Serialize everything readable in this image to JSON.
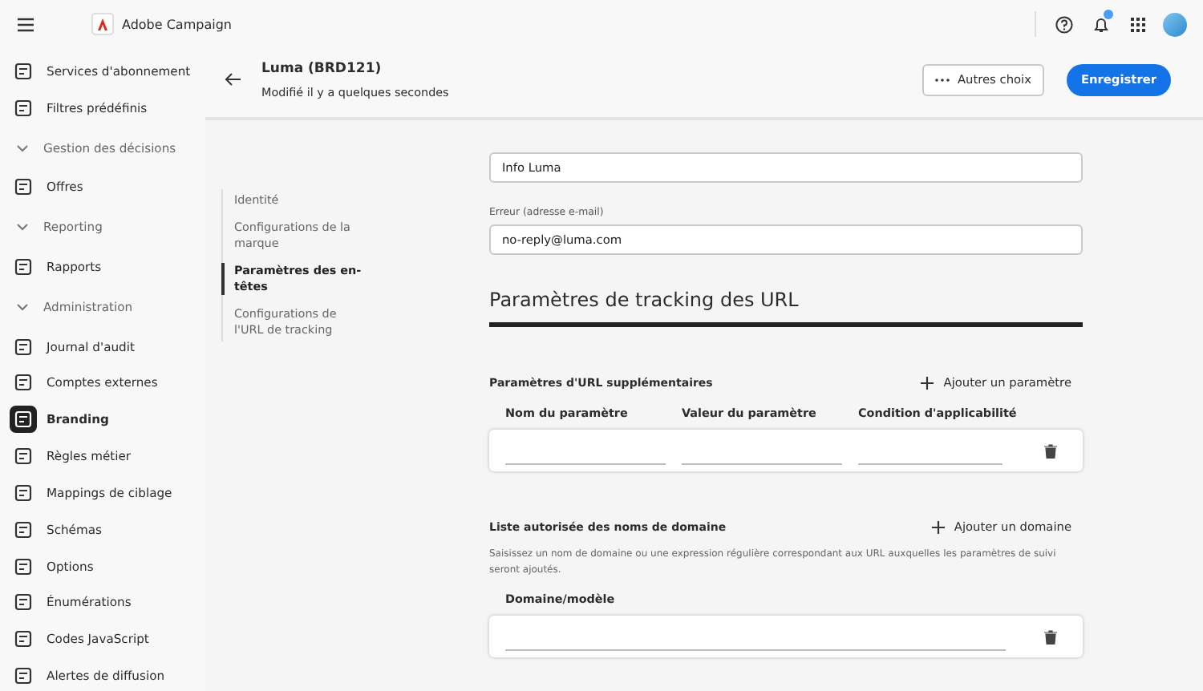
{
  "app": {
    "title": "Adobe Campaign",
    "notifications": true
  },
  "sidebar": {
    "items": [
      {
        "kind": "item",
        "label": "Services d'abonnement",
        "selected": false
      },
      {
        "kind": "item",
        "label": "Filtres prédéfinis",
        "selected": false
      },
      {
        "kind": "group",
        "label": "Gestion des décisions",
        "expanded": true
      },
      {
        "kind": "item",
        "label": "Offres",
        "selected": false
      },
      {
        "kind": "group",
        "label": "Reporting",
        "expanded": true
      },
      {
        "kind": "item",
        "label": "Rapports",
        "selected": false
      },
      {
        "kind": "group",
        "label": "Administration",
        "expanded": true
      },
      {
        "kind": "item",
        "label": "Journal d'audit",
        "selected": false
      },
      {
        "kind": "item",
        "label": "Comptes externes",
        "selected": false
      },
      {
        "kind": "item",
        "label": "Branding",
        "selected": true
      },
      {
        "kind": "item",
        "label": "Règles métier",
        "selected": false
      },
      {
        "kind": "item",
        "label": "Mappings de ciblage",
        "selected": false
      },
      {
        "kind": "item",
        "label": "Schémas",
        "selected": false
      },
      {
        "kind": "item",
        "label": "Options",
        "selected": false
      },
      {
        "kind": "item",
        "label": "Énumérations",
        "selected": false
      },
      {
        "kind": "item",
        "label": "Codes JavaScript",
        "selected": false
      },
      {
        "kind": "item",
        "label": "Alertes de diffusion",
        "selected": false
      }
    ]
  },
  "header": {
    "title": "Luma (BRD121)",
    "subtitle": "Modifié il y a quelques secondes",
    "more_button": "Autres choix",
    "save_button": "Enregistrer"
  },
  "section_nav": [
    {
      "label": "Identité",
      "selected": false
    },
    {
      "label": "Configurations de la marque",
      "selected": false
    },
    {
      "label": "Paramètres des en-têtes",
      "selected": true
    },
    {
      "label": "Configurations de l'URL de tracking",
      "selected": false
    }
  ],
  "form": {
    "fields": [
      {
        "value": "Info Luma"
      },
      {
        "label": "Erreur (adresse e-mail)",
        "value": "no-reply@luma.com"
      }
    ],
    "section_title": "Paramètres de tracking des URL",
    "url_params": {
      "title": "Paramètres d'URL supplémentaires",
      "add_button": "Ajouter un paramètre",
      "columns": [
        "Nom du paramètre",
        "Valeur du paramètre",
        "Condition d'applicabilité"
      ]
    },
    "domains": {
      "title": "Liste autorisée des noms de domaine",
      "add_button": "Ajouter un domaine",
      "description": "Saisissez un nom de domaine ou une expression régulière correspondant aux URL auxquelles les paramètres de suivi seront ajoutés.",
      "columns": [
        "Domaine/modèle"
      ]
    }
  }
}
